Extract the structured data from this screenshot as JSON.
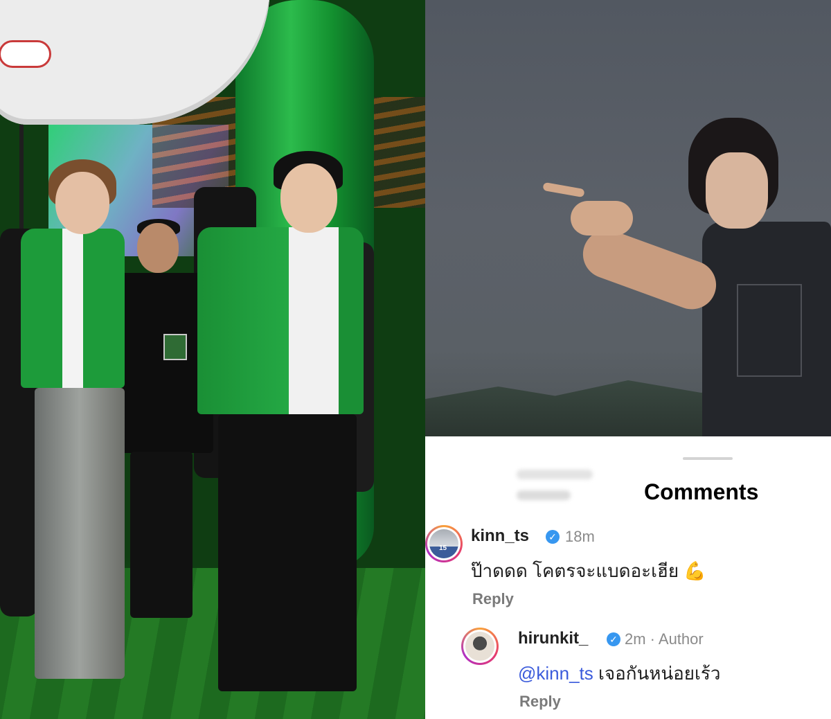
{
  "comments_panel": {
    "title": "Comments"
  },
  "comments": [
    {
      "username": "kinn_ts",
      "verified": true,
      "time": "18m",
      "text": "ป๊าดดด โคตรจะแบดอะเฮีย",
      "emoji": "💪",
      "reply_label": "Reply",
      "avatar_icon": "avatar-photo-jersey-15"
    },
    {
      "username": "hirunkit_",
      "verified": true,
      "time": "2m · Author",
      "mention": "@kinn_ts",
      "text": "เจอกันหน่อยเร้ว",
      "reply_label": "Reply",
      "avatar_icon": "avatar-photo-cartoon"
    }
  ],
  "colors": {
    "verified_badge": "#3797f0",
    "mention": "#3b5bdb",
    "story_ring": [
      "#f9a23a",
      "#e63a6e",
      "#b02fc4"
    ]
  }
}
